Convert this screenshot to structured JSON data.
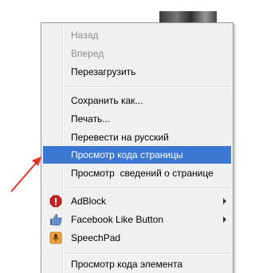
{
  "menu": {
    "items": [
      {
        "label": "Назад",
        "state": "disabled"
      },
      {
        "label": "Вперед",
        "state": "disabled"
      },
      {
        "label": "Перезагрузить",
        "state": "enabled"
      },
      {
        "label": "Сохранить как...",
        "state": "enabled"
      },
      {
        "label": "Печать...",
        "state": "enabled"
      },
      {
        "label": "Перевести на русский",
        "state": "enabled"
      },
      {
        "label": "Просмотр кода страницы",
        "state": "highlighted"
      },
      {
        "label": "Просмотр  сведений о странице",
        "state": "enabled"
      },
      {
        "label": "AdBlock",
        "state": "enabled",
        "icon": "adblock-icon",
        "submenu": true
      },
      {
        "label": "Facebook Like Button",
        "state": "enabled",
        "icon": "thumbs-up-icon",
        "submenu": true
      },
      {
        "label": "SpeechPad",
        "state": "enabled",
        "icon": "speechpad-icon"
      },
      {
        "label": "Просмотр кода элемента",
        "state": "enabled"
      }
    ]
  },
  "colors": {
    "highlight": "#3a78d4",
    "annotation_arrow": "#e0332e",
    "adblock_red": "#c8201d"
  }
}
